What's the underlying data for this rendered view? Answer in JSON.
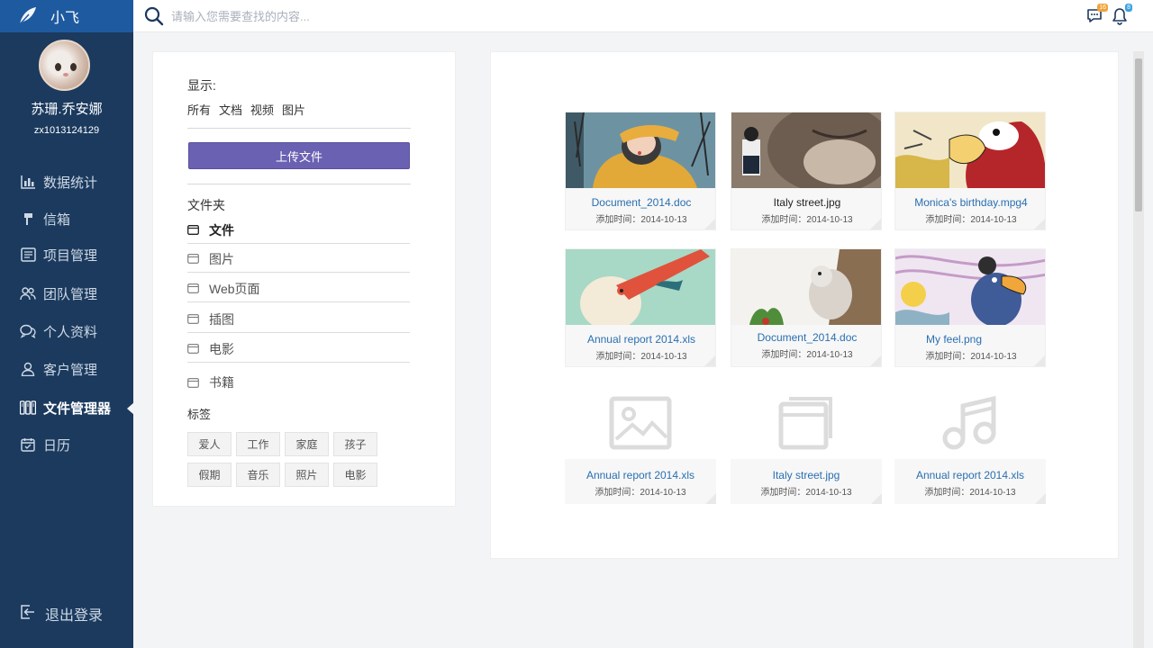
{
  "app": {
    "name": "小飞",
    "logo_icon": "feather-icon"
  },
  "user": {
    "name": "苏珊.乔安娜",
    "id": "zx1013124129"
  },
  "search": {
    "placeholder": "请输入您需要查找的内容..."
  },
  "notifications": {
    "messages_count": "16",
    "alerts_count": "8"
  },
  "nav": [
    {
      "label": "数据统计",
      "icon": "bar-chart-icon"
    },
    {
      "label": "信箱",
      "icon": "mail-icon"
    },
    {
      "label": "项目管理",
      "icon": "project-icon"
    },
    {
      "label": "团队管理",
      "icon": "team-icon"
    },
    {
      "label": "个人资料",
      "icon": "chat-icon"
    },
    {
      "label": "客户管理",
      "icon": "user-icon"
    },
    {
      "label": "文件管理器",
      "icon": "files-icon",
      "active": true
    },
    {
      "label": "日历",
      "icon": "calendar-icon"
    }
  ],
  "logout": {
    "label": "退出登录"
  },
  "filters": {
    "title": "显示:",
    "options": [
      "所有",
      "文档",
      "视频",
      "图片"
    ]
  },
  "upload": {
    "label": "上传文件"
  },
  "folders": {
    "title": "文件夹",
    "items": [
      "文件",
      "图片",
      "Web页面",
      "插图",
      "电影",
      "书籍"
    ]
  },
  "tags": {
    "title": "标签",
    "items": [
      "爱人",
      "工作",
      "家庭",
      "孩子",
      "假期",
      "音乐",
      "照片",
      "电影"
    ]
  },
  "files": [
    {
      "name": "Document_2014.doc",
      "date": "添加时间：2014-10-13",
      "thumb": "illustration-girl"
    },
    {
      "name": "Italy street.jpg",
      "date": "添加时间：2014-10-13",
      "thumb": "photo-wolf"
    },
    {
      "name": "Monica's birthday.mpg4",
      "date": "添加时间：2014-10-13",
      "thumb": "illustration-bird"
    },
    {
      "name": "Annual report 2014.xls",
      "date": "添加时间：2014-10-13",
      "thumb": "illustration-pelican"
    },
    {
      "name": "Document_2014.doc",
      "date": "添加时间：2014-10-13",
      "thumb": "photo-squirrel"
    },
    {
      "name": "My feel.png",
      "date": "添加时间：2014-10-13",
      "thumb": "illustration-toucan"
    },
    {
      "name": "Annual report 2014.xls",
      "date": "添加时间：2014-10-13",
      "thumb": "image-file-icon"
    },
    {
      "name": "Italy street.jpg",
      "date": "添加时间：2014-10-13",
      "thumb": "window-file-icon"
    },
    {
      "name": "Annual report 2014.xls",
      "date": "添加时间：2014-10-13",
      "thumb": "music-file-icon"
    }
  ],
  "colors": {
    "sidebar": "#1b3a5e",
    "logo_bar": "#1e5aa0",
    "upload_button": "#6b61b3",
    "link": "#2a6fb0"
  }
}
